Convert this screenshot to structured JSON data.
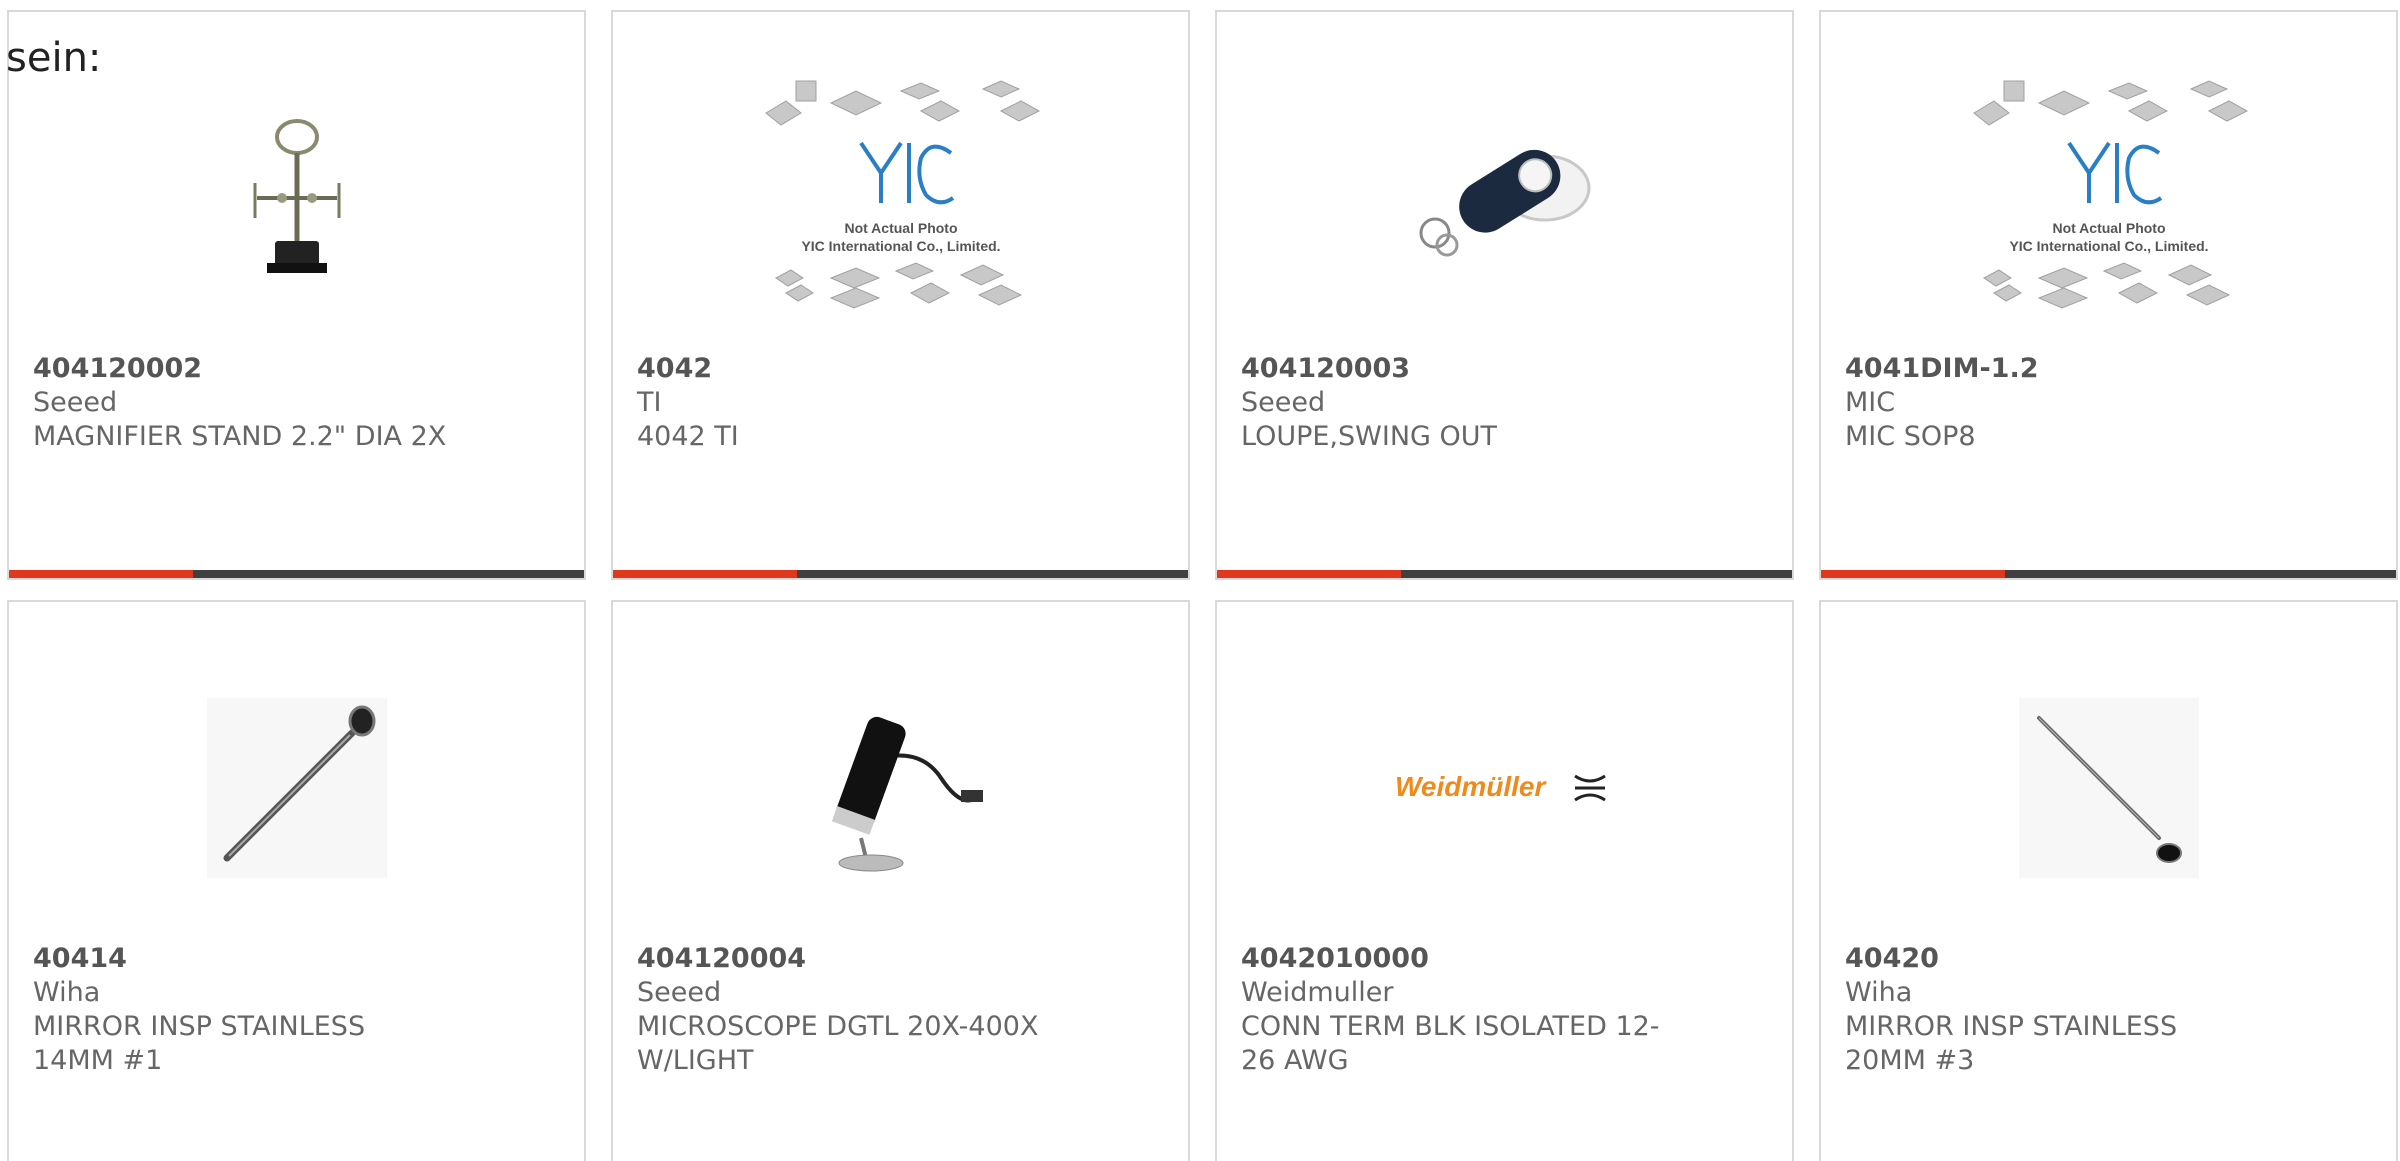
{
  "page": {
    "fragment_text": "sein:"
  },
  "colors": {
    "accent": "#e0381c",
    "bar_dark": "#404040",
    "card_border": "#d9d9d9"
  },
  "products": [
    {
      "part": "404120002",
      "brand": "Seeed",
      "desc": "MAGNIFIER STAND 2.2\" DIA 2X",
      "icon": "magnifier-stand-image"
    },
    {
      "part": "4042",
      "brand": "TI",
      "desc": "4042 TI",
      "icon": "yic-placeholder-image",
      "image_caption_1": "Not Actual Photo",
      "image_caption_2": "YIC International Co., Limited."
    },
    {
      "part": "404120003",
      "brand": "Seeed",
      "desc": "LOUPE,SWING OUT",
      "icon": "loupe-image"
    },
    {
      "part": "4041DIM-1.2",
      "brand": "MIC",
      "desc": "MIC SOP8",
      "icon": "yic-placeholder-image",
      "image_caption_1": "Not Actual Photo",
      "image_caption_2": "YIC International Co., Limited."
    },
    {
      "part": "40414",
      "brand": "Wiha",
      "desc": "MIRROR INSP STAINLESS 14MM #1",
      "icon": "inspection-mirror-image"
    },
    {
      "part": "404120004",
      "brand": "Seeed",
      "desc": "MICROSCOPE DGTL 20X-400X W/LIGHT",
      "icon": "digital-microscope-image"
    },
    {
      "part": "4042010000",
      "brand": "Weidmuller",
      "desc": "CONN TERM BLK ISOLATED 12-26 AWG",
      "icon": "weidmuller-logo",
      "logo_text": "Weidmüller"
    },
    {
      "part": "40420",
      "brand": "Wiha",
      "desc": "MIRROR INSP STAINLESS 20MM #3",
      "icon": "inspection-mirror-image"
    }
  ]
}
